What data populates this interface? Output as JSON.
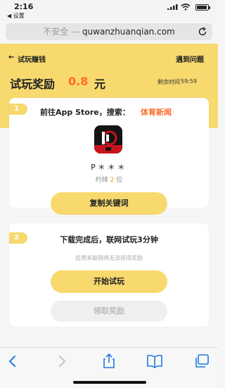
{
  "status_bar": {
    "time": "2:16",
    "back_app": "设置"
  },
  "browser": {
    "insecure_label": "不安全 —",
    "domain": "quwanzhuanqian.com"
  },
  "nav": {
    "back_arrow": "←",
    "title": "试玩赚钱",
    "help": "遇到问题"
  },
  "reward": {
    "title": "试玩奖励",
    "amount": "0.8",
    "unit": "元",
    "countdown_label": "剩余时间",
    "countdown": "59:59"
  },
  "step1": {
    "number": "1",
    "instruction": "前往App Store，搜索：",
    "keyword": "体育新闻",
    "app_name": "P＊＊＊",
    "rank_prefix": "约排",
    "rank_value": "2",
    "rank_suffix": "位",
    "copy_button": "复制关键词"
  },
  "step2": {
    "number": "2",
    "instruction": "下载完成后，联网试玩3分钟",
    "note": "应用未联网将无法获得奖励",
    "start_button": "开始试玩",
    "claim_button": "领取奖励"
  },
  "colors": {
    "brand_yellow": "#f7d96e",
    "accent_orange": "#ff6a2a",
    "ios_blue": "#1f7ae0",
    "disabled_gray": "#bdbdbd"
  },
  "battery_level_percent": 90
}
